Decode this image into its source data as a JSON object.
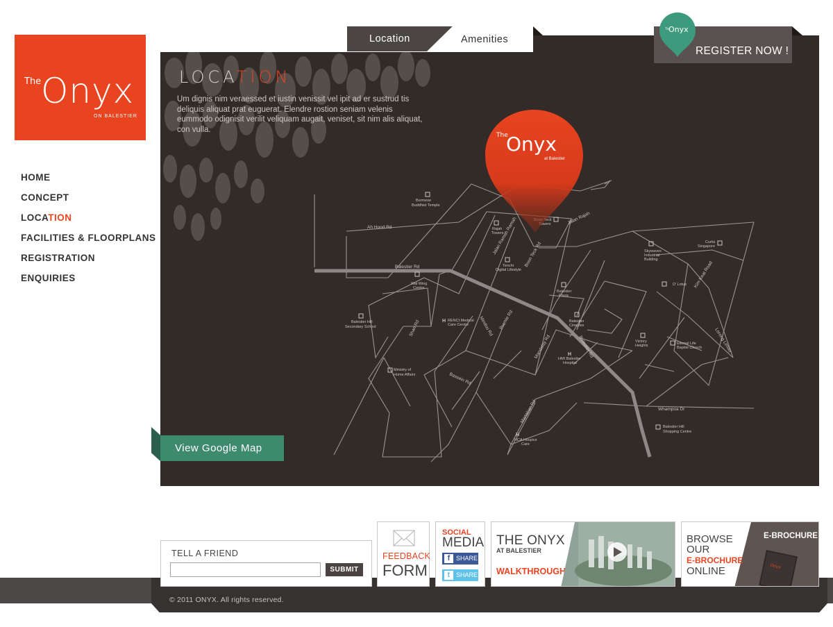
{
  "logo": {
    "the": "The",
    "name": "Onyx",
    "sub": "ON BALESTIER"
  },
  "nav": {
    "items": [
      {
        "label": "HOME"
      },
      {
        "label": "CONCEPT"
      },
      {
        "label_a": "LOCA",
        "label_b": "TION"
      },
      {
        "label": "FACILITIES & FLOORPLANS"
      },
      {
        "label": "REGISTRATION"
      },
      {
        "label": "ENQUIRIES"
      }
    ]
  },
  "tabs": {
    "location": "Location",
    "amenities": "Amenities"
  },
  "register": {
    "label": "REGISTER NOW !"
  },
  "section": {
    "title_a": "LOCA",
    "title_b": "TION",
    "description": "Um dignis nim veraessed et iustin venissit vel ipit ad er sustrud tis deliquis aliquat prat euguerat. Elendre rostion seniam velenis eummodo odignisit verilit veliquam augait, veniset, sit nim alis aliquat, con vulla."
  },
  "map": {
    "pin": {
      "the": "The",
      "name": "Onyx",
      "sub": "at Balestier"
    },
    "roads": [
      "Balestier Rd",
      "Ah Hood Rd",
      "Jalan Rajah",
      "Jalan Ramah Ramah",
      "Boon Teck Rd",
      "Shan Rd",
      "Mindou Rd",
      "Pramie Rd",
      "Mandalay Rd",
      "Balestier Rd",
      "Bassein Rd",
      "Martaban Rd",
      "Whampoa Dr",
      "Kim Keat Road",
      "Lorong Limau"
    ],
    "places": [
      "Burmese Buddhist Temple",
      "Rajah Towers",
      "Boon Teck Towers",
      "Tenchi Digital Lifestyle",
      "Wai Wing Centre",
      "Balestier Hill Secondary School",
      "RENCI Medical Care Centre",
      "Ministry of Home Affairs",
      "Balestier Plaza",
      "Balestier Cineplex",
      "HMI Balestier Hospital",
      "HCA Hospice Care",
      "Skywaves Industrial Building",
      "Curtis Singapore",
      "D' Lotus",
      "Victory Heights",
      "Eternal Life Baptist Church",
      "Balestier Hill Shopping Centre"
    ]
  },
  "google_map": {
    "label": "View Google Map"
  },
  "tell_friend": {
    "label": "TELL A FRIEND",
    "input_value": "",
    "submit": "SUBMIT"
  },
  "feedback": {
    "line1": "FEEDBACK",
    "line2": "FORM"
  },
  "social": {
    "line1": "SOCIAL",
    "line2": "MEDIA",
    "facebook": "SHARE",
    "twitter": "SHARE"
  },
  "walkthrough": {
    "line1": "THE ONYX",
    "line2": "AT BALESTIER",
    "line3": "WALKTHROUGH"
  },
  "brochure": {
    "line1": "BROWSE",
    "line2": "OUR",
    "line3": "E-BROCHURE",
    "line4": "ONLINE",
    "tag": "E-BROCHURE"
  },
  "footer": {
    "copyright": "© 2011 ONYX. All rights reserved."
  },
  "colors": {
    "accent": "#e8441f",
    "panel": "#332b27",
    "green": "#3d8a6e",
    "dark": "#4c4847"
  }
}
